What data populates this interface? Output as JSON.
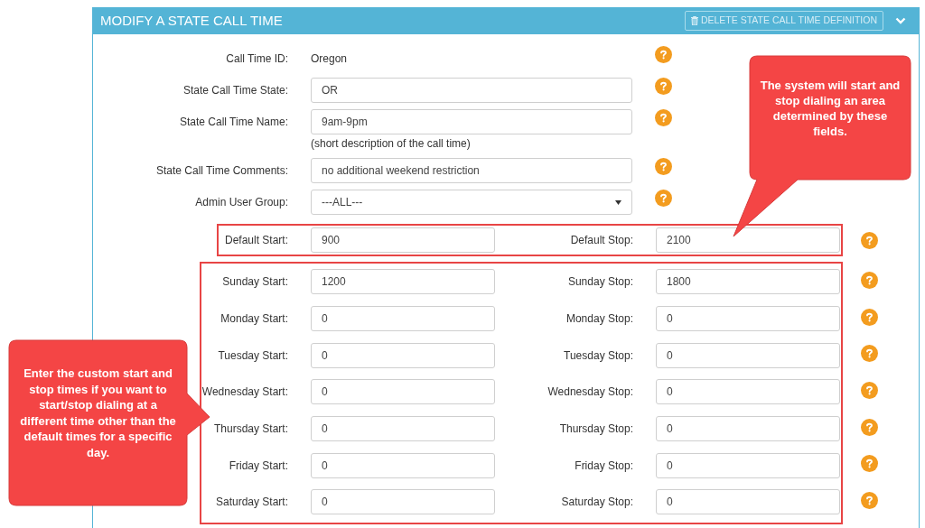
{
  "header": {
    "title": "MODIFY A STATE CALL TIME",
    "delete_button": "DELETE STATE CALL TIME DEFINITION"
  },
  "fields": [
    {
      "kind": "static",
      "label": "Call Time ID:",
      "value": "Oregon"
    },
    {
      "kind": "input",
      "label": "State Call Time State:",
      "value": "OR"
    },
    {
      "kind": "input",
      "label": "State Call Time Name:",
      "value": "9am-9pm",
      "note": "(short description of the call time)"
    },
    {
      "kind": "input",
      "label": "State Call Time Comments:",
      "value": "no additional weekend restriction"
    },
    {
      "kind": "select",
      "label": "Admin User Group:",
      "value": "---ALL---"
    }
  ],
  "default_times": {
    "start_label": "Default Start:",
    "start_value": "900",
    "stop_label": "Default Stop:",
    "stop_value": "2100"
  },
  "day_times": [
    {
      "start_label": "Sunday Start:",
      "start_value": "1200",
      "stop_label": "Sunday Stop:",
      "stop_value": "1800"
    },
    {
      "start_label": "Monday Start:",
      "start_value": "0",
      "stop_label": "Monday Stop:",
      "stop_value": "0"
    },
    {
      "start_label": "Tuesday Start:",
      "start_value": "0",
      "stop_label": "Tuesday Stop:",
      "stop_value": "0"
    },
    {
      "start_label": "Wednesday Start:",
      "start_value": "0",
      "stop_label": "Wednesday Stop:",
      "stop_value": "0"
    },
    {
      "start_label": "Thursday Start:",
      "start_value": "0",
      "stop_label": "Thursday Stop:",
      "stop_value": "0"
    },
    {
      "start_label": "Friday Start:",
      "start_value": "0",
      "stop_label": "Friday Stop:",
      "stop_value": "0"
    },
    {
      "start_label": "Saturday Start:",
      "start_value": "0",
      "stop_label": "Saturday Stop:",
      "stop_value": "0"
    }
  ],
  "callouts": [
    {
      "text": "The system will start and stop dialing an area determined by these fields."
    },
    {
      "text": "Enter the custom start and stop times if you want to start/stop dialing at a different time other than the default times for a specific day."
    }
  ]
}
